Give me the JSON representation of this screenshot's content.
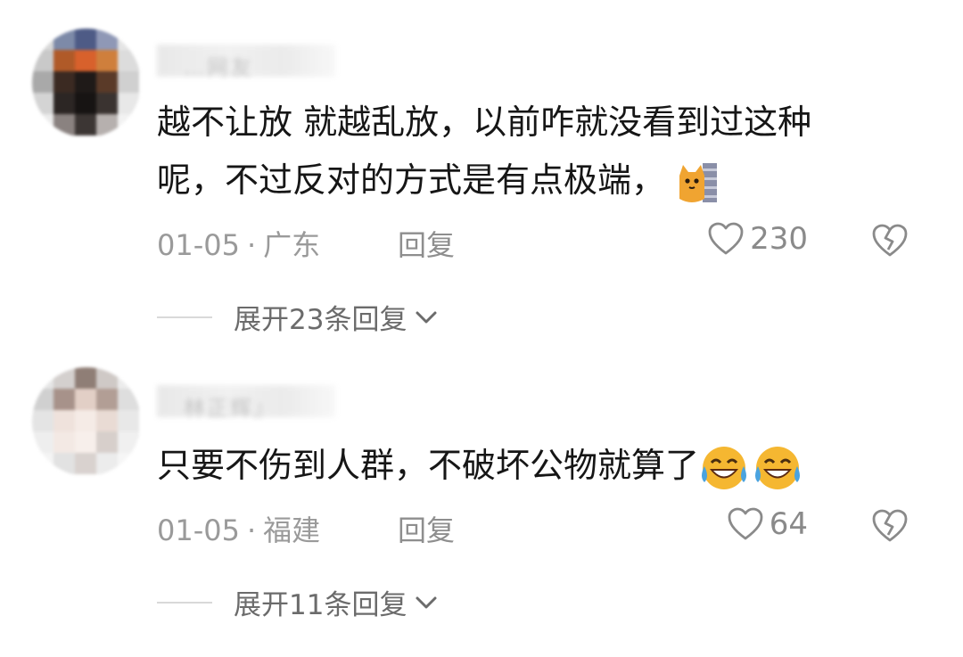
{
  "comments": [
    {
      "username": "…网友",
      "text_line1": "越不让放 就越乱放，以前咋就没看到过这种",
      "text_line2": "呢，不过反对的方式是有点极端，",
      "emoji": "cat-peek-emoji",
      "date": "01-05",
      "separator": "·",
      "location": "广东",
      "reply_label": "回复",
      "likes": "230",
      "expand_label": "展开23条回复"
    },
    {
      "username": "林正辉』",
      "text_line1": "只要不伤到人群，不破坏公物就算了",
      "emoji": "laughing-tears-emoji",
      "date": "01-05",
      "separator": "·",
      "location": "福建",
      "reply_label": "回复",
      "likes": "64",
      "expand_label": "展开11条回复"
    }
  ],
  "colors": {
    "text": "#161616",
    "meta": "#9a9a9a",
    "accent_emoji": "#f5b731"
  }
}
